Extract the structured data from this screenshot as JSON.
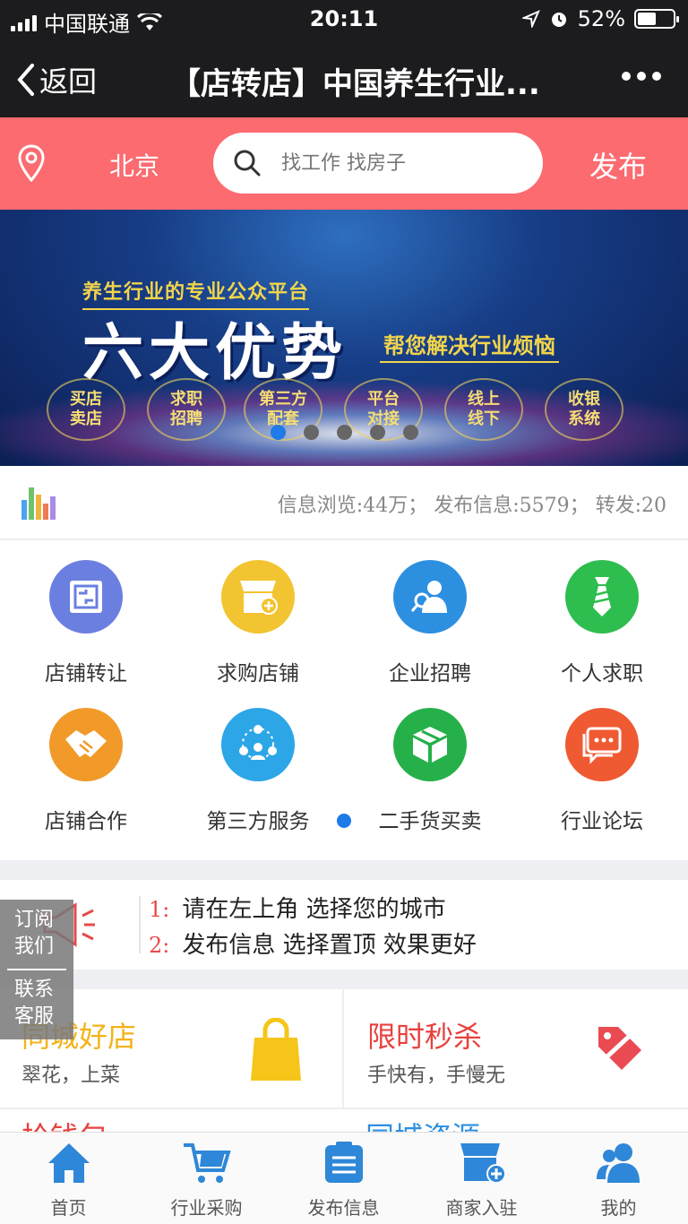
{
  "status": {
    "carrier": "中国联通",
    "time": "20:11",
    "battery": "52%",
    "battery_level": 0.52
  },
  "nav": {
    "back_label": "返回",
    "title": "【店转店】中国养生行业..."
  },
  "search": {
    "city": "北京",
    "placeholder": "找工作 找房子",
    "publish_label": "发布"
  },
  "banner": {
    "subtitle": "养生行业的专业公众平台",
    "title": "六大优势",
    "tagline": "帮您解决行业烦恼",
    "features": [
      "买店\n卖店",
      "求职\n招聘",
      "第三方\n配套",
      "平台\n对接",
      "线上\n线下",
      "收银\n系统"
    ],
    "slide_count": 5,
    "active_slide": 1
  },
  "stats": {
    "text": "信息浏览:44万；  发布信息:5579；  转发:20"
  },
  "grid": {
    "items": [
      {
        "label": "店铺转让",
        "icon": "transfer-icon",
        "color": "#6b7fe0"
      },
      {
        "label": "求购店铺",
        "icon": "shop-add-icon",
        "color": "#f3c431"
      },
      {
        "label": "企业招聘",
        "icon": "recruit-icon",
        "color": "#2d8fe0"
      },
      {
        "label": "个人求职",
        "icon": "tie-icon",
        "color": "#2ebd4f"
      },
      {
        "label": "店铺合作",
        "icon": "handshake-icon",
        "color": "#f19a29"
      },
      {
        "label": "第三方服务",
        "icon": "people-network-icon",
        "color": "#2ca6e6"
      },
      {
        "label": "二手货买卖",
        "icon": "box-icon",
        "color": "#25b04a"
      },
      {
        "label": "行业论坛",
        "icon": "chat-icon",
        "color": "#f05a32"
      }
    ]
  },
  "notice": {
    "lines": [
      {
        "num": "1:",
        "text": "请在左上角 选择您的城市"
      },
      {
        "num": "2:",
        "text": "发布信息 选择置顶 效果更好"
      }
    ]
  },
  "promos": {
    "left": {
      "title": "同城好店",
      "subtitle": "翠花，上菜",
      "title_color": "#f2b318"
    },
    "right": {
      "title": "限时秒杀",
      "subtitle": "手快有，手慢无",
      "title_color": "#e8413e"
    },
    "row2_left": "拾钱包",
    "row2_right": "同城资源"
  },
  "side": {
    "subscribe": "订阅\n我们",
    "service": "联系\n客服"
  },
  "tabbar": {
    "tabs": [
      {
        "label": "首页",
        "icon": "home-icon",
        "active": true
      },
      {
        "label": "行业采购",
        "icon": "cart-icon",
        "active": false
      },
      {
        "label": "发布信息",
        "icon": "list-icon",
        "active": false
      },
      {
        "label": "商家入驻",
        "icon": "store-icon",
        "active": false
      },
      {
        "label": "我的",
        "icon": "user-icon",
        "active": false
      }
    ]
  }
}
